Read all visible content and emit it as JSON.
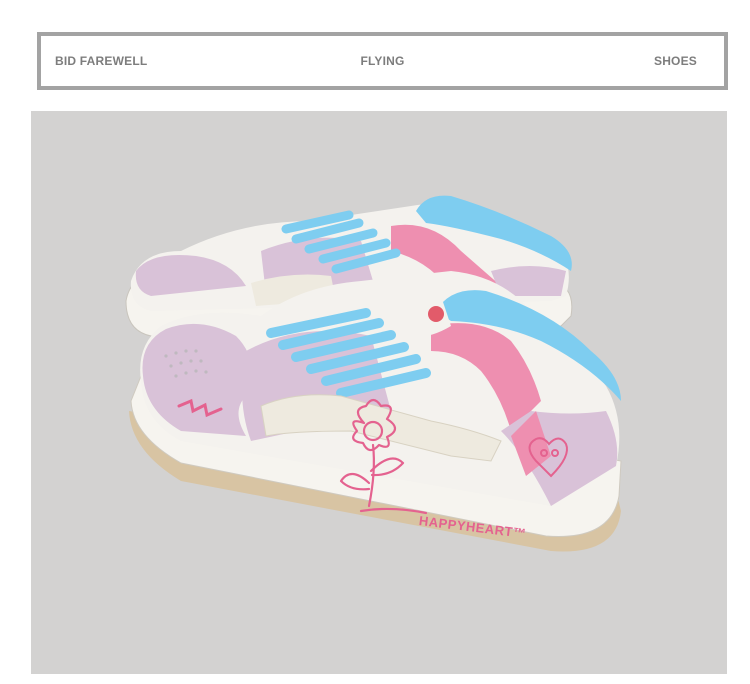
{
  "banner": {
    "left_text": "BID FAREWELL",
    "center_text": "FLYING",
    "right_text": "SHOES"
  },
  "photo": {
    "subject": "pair of pink, lilac and white low-top sneakers with sky-blue laces",
    "shoe_print_text": "HAPPYHEART™",
    "colors": {
      "background": "#d3d2d1",
      "upper_white": "#f4f2ee",
      "lilac": "#d9c2d8",
      "pink": "#ee8fb0",
      "laces": "#7ecdf0",
      "sole": "#f6f4ef",
      "sole_stripe": "#d8c4a3",
      "print": "#e4628f"
    }
  }
}
